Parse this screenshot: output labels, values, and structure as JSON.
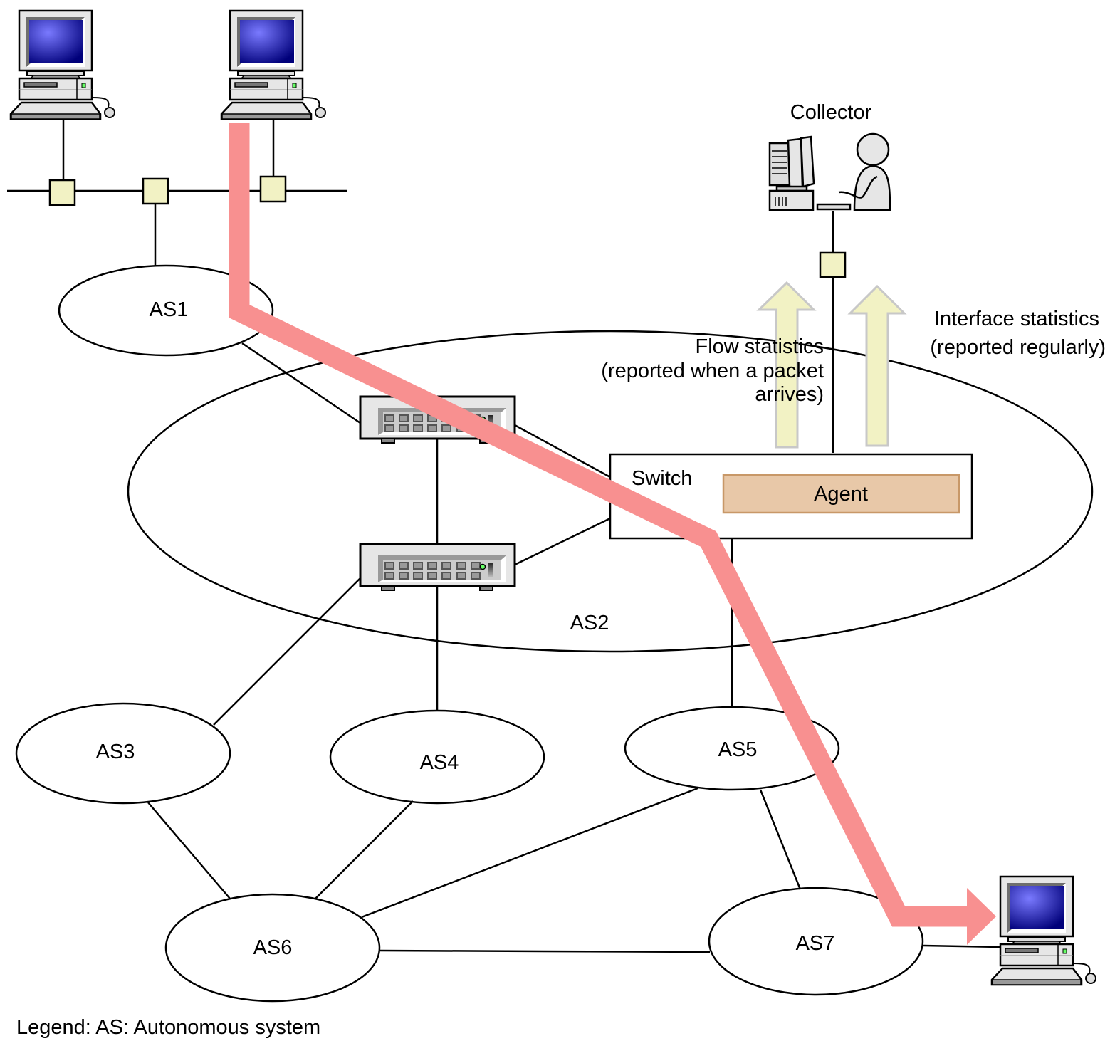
{
  "labels": {
    "collector": "Collector",
    "flow_stats": [
      "Flow statistics",
      "(reported when a packet",
      "arrives)"
    ],
    "interface_stats": [
      "Interface statistics",
      "(reported regularly)"
    ],
    "switch": "Switch",
    "agent": "Agent",
    "as": [
      "AS1",
      "AS2",
      "AS3",
      "AS4",
      "AS5",
      "AS6",
      "AS7"
    ],
    "legend": "Legend:  AS: Autonomous system"
  },
  "colors": {
    "flow_path": "#f89090",
    "report_arrow": "#f2f2c4",
    "connector": "#f2f2c4",
    "agent_fill": "#e8c8a8",
    "agent_border": "#c89868"
  },
  "icons": {
    "host": "computer-icon",
    "router": "network-switch-icon",
    "collector": "operator-at-computer-icon"
  }
}
